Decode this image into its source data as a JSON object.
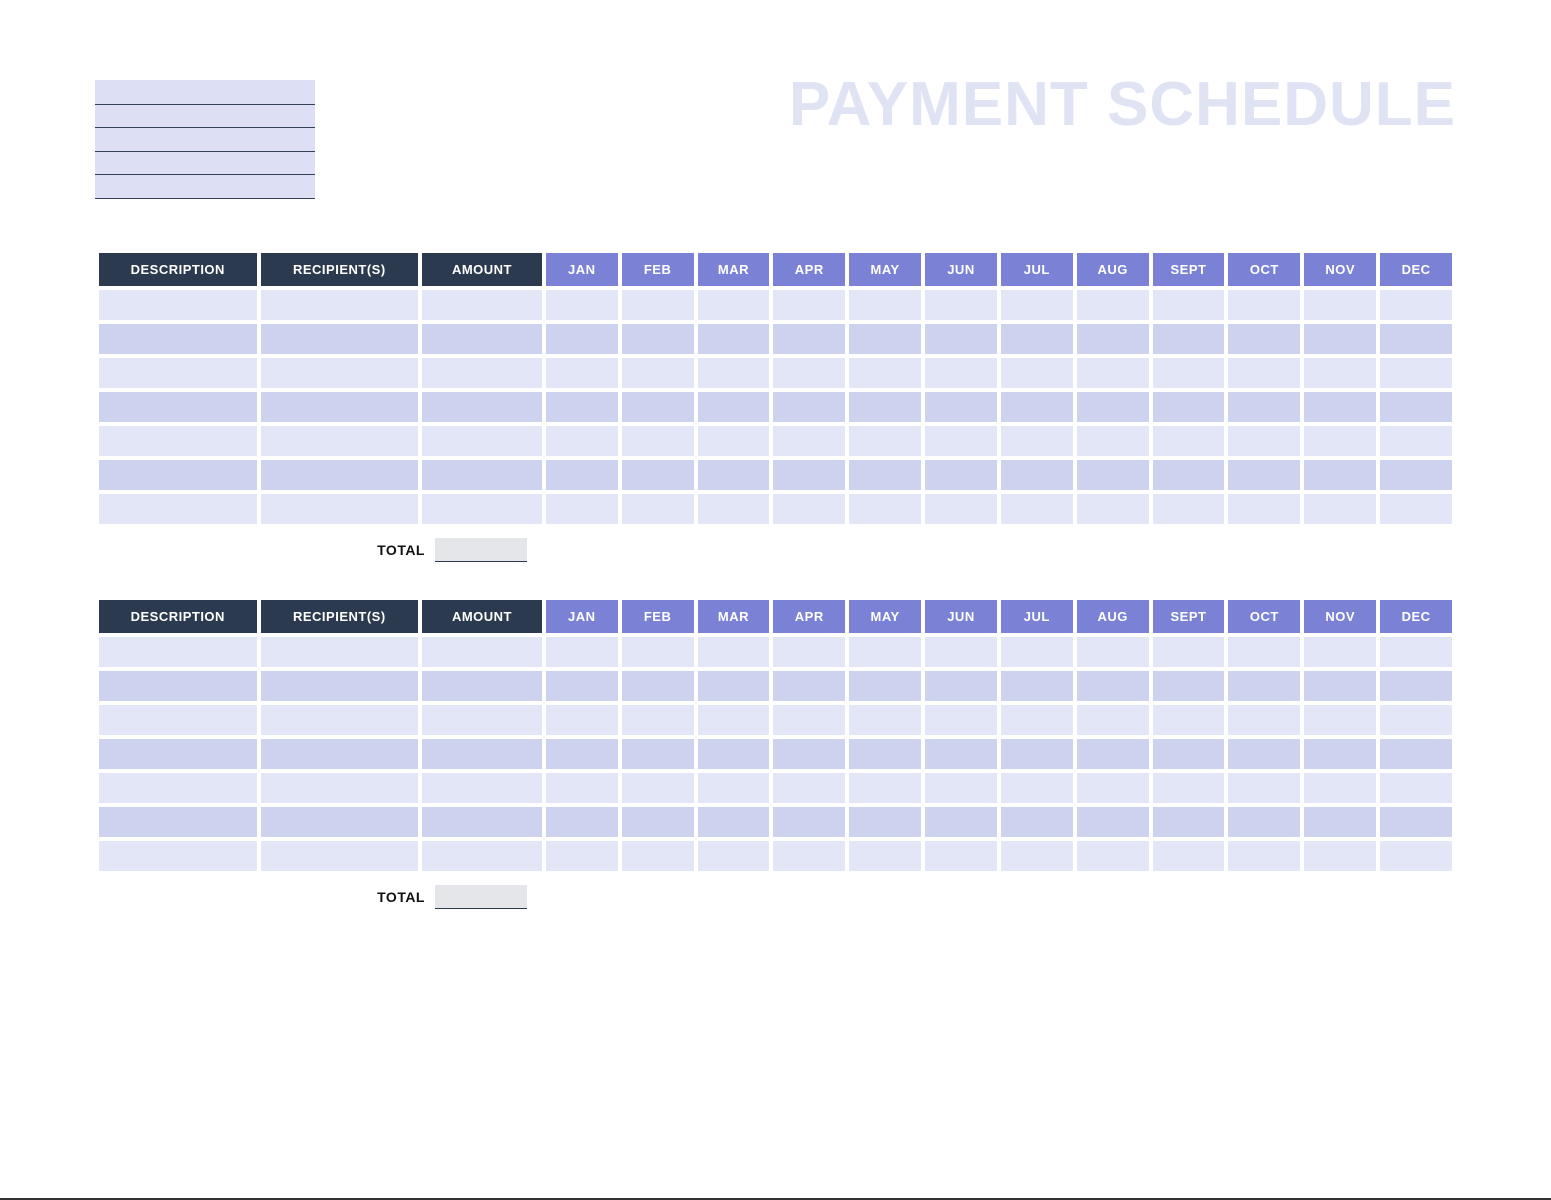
{
  "title": "PAYMENT SCHEDULE",
  "header_info": {
    "lines": [
      "",
      "",
      "",
      "",
      ""
    ]
  },
  "columns": {
    "description": "DESCRIPTION",
    "recipients": "RECIPIENT(S)",
    "amount": "AMOUNT",
    "months": [
      "JAN",
      "FEB",
      "MAR",
      "APR",
      "MAY",
      "JUN",
      "JUL",
      "AUG",
      "SEPT",
      "OCT",
      "NOV",
      "DEC"
    ]
  },
  "total_label": "TOTAL",
  "sections": [
    {
      "rows": [
        {
          "description": "",
          "recipients": "",
          "amount": "",
          "months": [
            "",
            "",
            "",
            "",
            "",
            "",
            "",
            "",
            "",
            "",
            "",
            ""
          ]
        },
        {
          "description": "",
          "recipients": "",
          "amount": "",
          "months": [
            "",
            "",
            "",
            "",
            "",
            "",
            "",
            "",
            "",
            "",
            "",
            ""
          ]
        },
        {
          "description": "",
          "recipients": "",
          "amount": "",
          "months": [
            "",
            "",
            "",
            "",
            "",
            "",
            "",
            "",
            "",
            "",
            "",
            ""
          ]
        },
        {
          "description": "",
          "recipients": "",
          "amount": "",
          "months": [
            "",
            "",
            "",
            "",
            "",
            "",
            "",
            "",
            "",
            "",
            "",
            ""
          ]
        },
        {
          "description": "",
          "recipients": "",
          "amount": "",
          "months": [
            "",
            "",
            "",
            "",
            "",
            "",
            "",
            "",
            "",
            "",
            "",
            ""
          ]
        },
        {
          "description": "",
          "recipients": "",
          "amount": "",
          "months": [
            "",
            "",
            "",
            "",
            "",
            "",
            "",
            "",
            "",
            "",
            "",
            ""
          ]
        },
        {
          "description": "",
          "recipients": "",
          "amount": "",
          "months": [
            "",
            "",
            "",
            "",
            "",
            "",
            "",
            "",
            "",
            "",
            "",
            ""
          ]
        }
      ],
      "total": ""
    },
    {
      "rows": [
        {
          "description": "",
          "recipients": "",
          "amount": "",
          "months": [
            "",
            "",
            "",
            "",
            "",
            "",
            "",
            "",
            "",
            "",
            "",
            ""
          ]
        },
        {
          "description": "",
          "recipients": "",
          "amount": "",
          "months": [
            "",
            "",
            "",
            "",
            "",
            "",
            "",
            "",
            "",
            "",
            "",
            ""
          ]
        },
        {
          "description": "",
          "recipients": "",
          "amount": "",
          "months": [
            "",
            "",
            "",
            "",
            "",
            "",
            "",
            "",
            "",
            "",
            "",
            ""
          ]
        },
        {
          "description": "",
          "recipients": "",
          "amount": "",
          "months": [
            "",
            "",
            "",
            "",
            "",
            "",
            "",
            "",
            "",
            "",
            "",
            ""
          ]
        },
        {
          "description": "",
          "recipients": "",
          "amount": "",
          "months": [
            "",
            "",
            "",
            "",
            "",
            "",
            "",
            "",
            "",
            "",
            "",
            ""
          ]
        },
        {
          "description": "",
          "recipients": "",
          "amount": "",
          "months": [
            "",
            "",
            "",
            "",
            "",
            "",
            "",
            "",
            "",
            "",
            "",
            ""
          ]
        },
        {
          "description": "",
          "recipients": "",
          "amount": "",
          "months": [
            "",
            "",
            "",
            "",
            "",
            "",
            "",
            "",
            "",
            "",
            "",
            ""
          ]
        }
      ],
      "total": ""
    }
  ]
}
